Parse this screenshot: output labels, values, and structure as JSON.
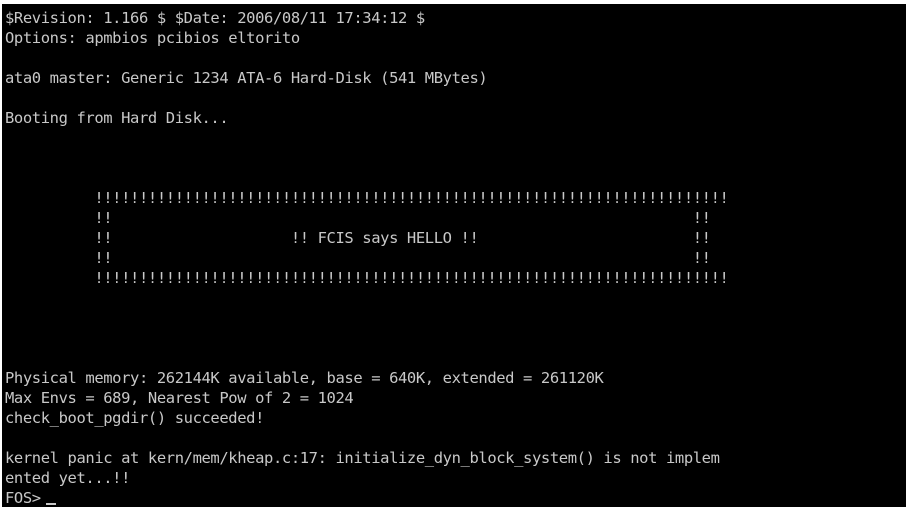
{
  "terminal": {
    "lines": {
      "revision": "$Revision: 1.166 $ $Date: 2006/08/11 17:34:12 $",
      "options": "Options: apmbios pcibios eltorito",
      "ata0": "ata0 master: Generic 1234 ATA-6 Hard-Disk (541 MBytes)",
      "booting": "Booting from Hard Disk...",
      "banner_top": "          !!!!!!!!!!!!!!!!!!!!!!!!!!!!!!!!!!!!!!!!!!!!!!!!!!!!!!!!!!!!!!!!!!!!!!!",
      "banner_side_1": "          !!                                                                 !!",
      "banner_hello": "          !!                    !! FCIS says HELLO !!                        !!",
      "banner_side_2": "          !!                                                                 !!",
      "banner_bottom": "          !!!!!!!!!!!!!!!!!!!!!!!!!!!!!!!!!!!!!!!!!!!!!!!!!!!!!!!!!!!!!!!!!!!!!!!",
      "physical_memory": "Physical memory: 262144K available, base = 640K, extended = 261120K",
      "max_envs": "Max Envs = 689, Nearest Pow of 2 = 1024",
      "check_boot": "check_boot_pgdir() succeeded!",
      "kernel_panic_1": "kernel panic at kern/mem/kheap.c:17: initialize_dyn_block_system() is not implem",
      "kernel_panic_2": "ented yet...!!",
      "prompt": "FOS>"
    },
    "colors": {
      "background": "#000000",
      "text": "#c8c8c8"
    }
  }
}
